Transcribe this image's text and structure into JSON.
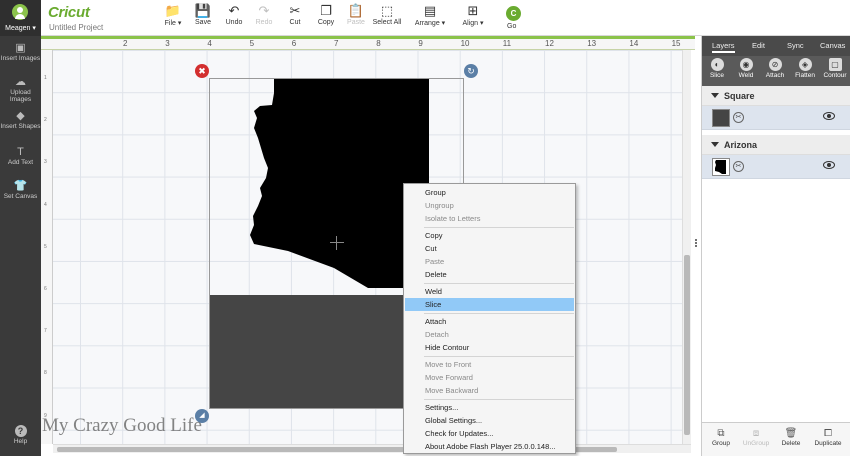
{
  "header": {
    "user_name": "Meagen ▾",
    "logo": "Cricut",
    "project_name": "Untitled Project",
    "toolbar": [
      {
        "label": "File ▾",
        "icon": "folder-icon",
        "glyph": "📁",
        "enabled": true
      },
      {
        "label": "Save",
        "icon": "save-icon",
        "glyph": "💾",
        "enabled": true
      },
      {
        "label": "Undo",
        "icon": "undo-icon",
        "glyph": "↶",
        "enabled": true
      },
      {
        "label": "Redo",
        "icon": "redo-icon",
        "glyph": "↷",
        "enabled": false
      },
      {
        "label": "Cut",
        "icon": "cut-icon",
        "glyph": "✂",
        "enabled": true
      },
      {
        "label": "Copy",
        "icon": "copy-icon",
        "glyph": "❐",
        "enabled": true
      },
      {
        "label": "Paste",
        "icon": "paste-icon",
        "glyph": "📋",
        "enabled": false
      },
      {
        "label": "Select All",
        "icon": "select-all-icon",
        "glyph": "⬚",
        "enabled": true
      },
      {
        "label": "Arrange ▾",
        "icon": "arrange-icon",
        "glyph": "▤",
        "enabled": true
      },
      {
        "label": "Align ▾",
        "icon": "align-icon",
        "glyph": "⊞",
        "enabled": true
      }
    ],
    "go_label": "Go",
    "go_glyph": "C"
  },
  "sidebar": {
    "items": [
      {
        "label": "Insert Images",
        "icon": "image-icon",
        "glyph": "▣"
      },
      {
        "label": "Upload Images",
        "icon": "cloud-upload-icon",
        "glyph": "☁"
      },
      {
        "label": "Insert Shapes",
        "icon": "shapes-icon",
        "glyph": "◆"
      },
      {
        "label": "Add Text",
        "icon": "text-icon",
        "glyph": "T"
      },
      {
        "label": "Set Canvas",
        "icon": "shirt-icon",
        "glyph": "👕"
      }
    ],
    "help_label": "Help",
    "help_glyph": "?"
  },
  "canvas": {
    "ruler_top": [
      "2",
      "3",
      "4",
      "5",
      "6",
      "7",
      "8",
      "9",
      "10",
      "11",
      "12",
      "13",
      "14",
      "15"
    ],
    "ruler_left": [
      "1",
      "2",
      "3",
      "4",
      "5",
      "6",
      "7",
      "8",
      "9"
    ],
    "watermark": "My Crazy Good Life",
    "close_glyph": "✖",
    "rotate_glyph": "↻",
    "scale_glyph": "◢"
  },
  "context_menu": {
    "items": [
      {
        "label": "Group",
        "enabled": true
      },
      {
        "label": "Ungroup",
        "enabled": false
      },
      {
        "label": "Isolate to Letters",
        "enabled": false
      },
      {
        "label": "Copy",
        "enabled": true
      },
      {
        "label": "Cut",
        "enabled": true
      },
      {
        "label": "Paste",
        "enabled": false
      },
      {
        "label": "Delete",
        "enabled": true
      },
      {
        "label": "Weld",
        "enabled": true
      },
      {
        "label": "Slice",
        "enabled": true,
        "highlighted": true
      },
      {
        "label": "Attach",
        "enabled": true
      },
      {
        "label": "Detach",
        "enabled": false
      },
      {
        "label": "Hide Contour",
        "enabled": true
      },
      {
        "label": "Move to Front",
        "enabled": false
      },
      {
        "label": "Move Forward",
        "enabled": false
      },
      {
        "label": "Move Backward",
        "enabled": false
      },
      {
        "label": "Settings...",
        "enabled": true
      },
      {
        "label": "Global Settings...",
        "enabled": true
      },
      {
        "label": "Check for Updates...",
        "enabled": true
      },
      {
        "label": "About Adobe Flash Player 25.0.0.148...",
        "enabled": true
      }
    ],
    "highlight_color": "#91c9f7"
  },
  "right_panel": {
    "tabs": [
      "Layers",
      "Edit",
      "Sync",
      "Canvas"
    ],
    "tools": [
      {
        "label": "Slice",
        "icon": "slice-icon",
        "glyph": "◐"
      },
      {
        "label": "Weld",
        "icon": "weld-icon",
        "glyph": "◉"
      },
      {
        "label": "Attach",
        "icon": "attach-icon",
        "glyph": "⊘"
      },
      {
        "label": "Flatten",
        "icon": "flatten-icon",
        "glyph": "◈"
      },
      {
        "label": "Contour",
        "icon": "contour-icon",
        "glyph": "▢"
      }
    ],
    "layers": [
      {
        "group": "Square",
        "color": "#454545"
      },
      {
        "group": "Arizona",
        "color": "#000000"
      }
    ],
    "bottom": [
      {
        "label": "Group",
        "icon": "group-icon",
        "glyph": "⧉",
        "enabled": true
      },
      {
        "label": "UnGroup",
        "icon": "ungroup-icon",
        "glyph": "⧈",
        "enabled": false
      },
      {
        "label": "Delete",
        "icon": "trash-icon",
        "glyph": "🗑",
        "enabled": true
      },
      {
        "label": "Duplicate",
        "icon": "duplicate-icon",
        "glyph": "⧠",
        "enabled": true
      }
    ],
    "accent": "#6aab30"
  }
}
